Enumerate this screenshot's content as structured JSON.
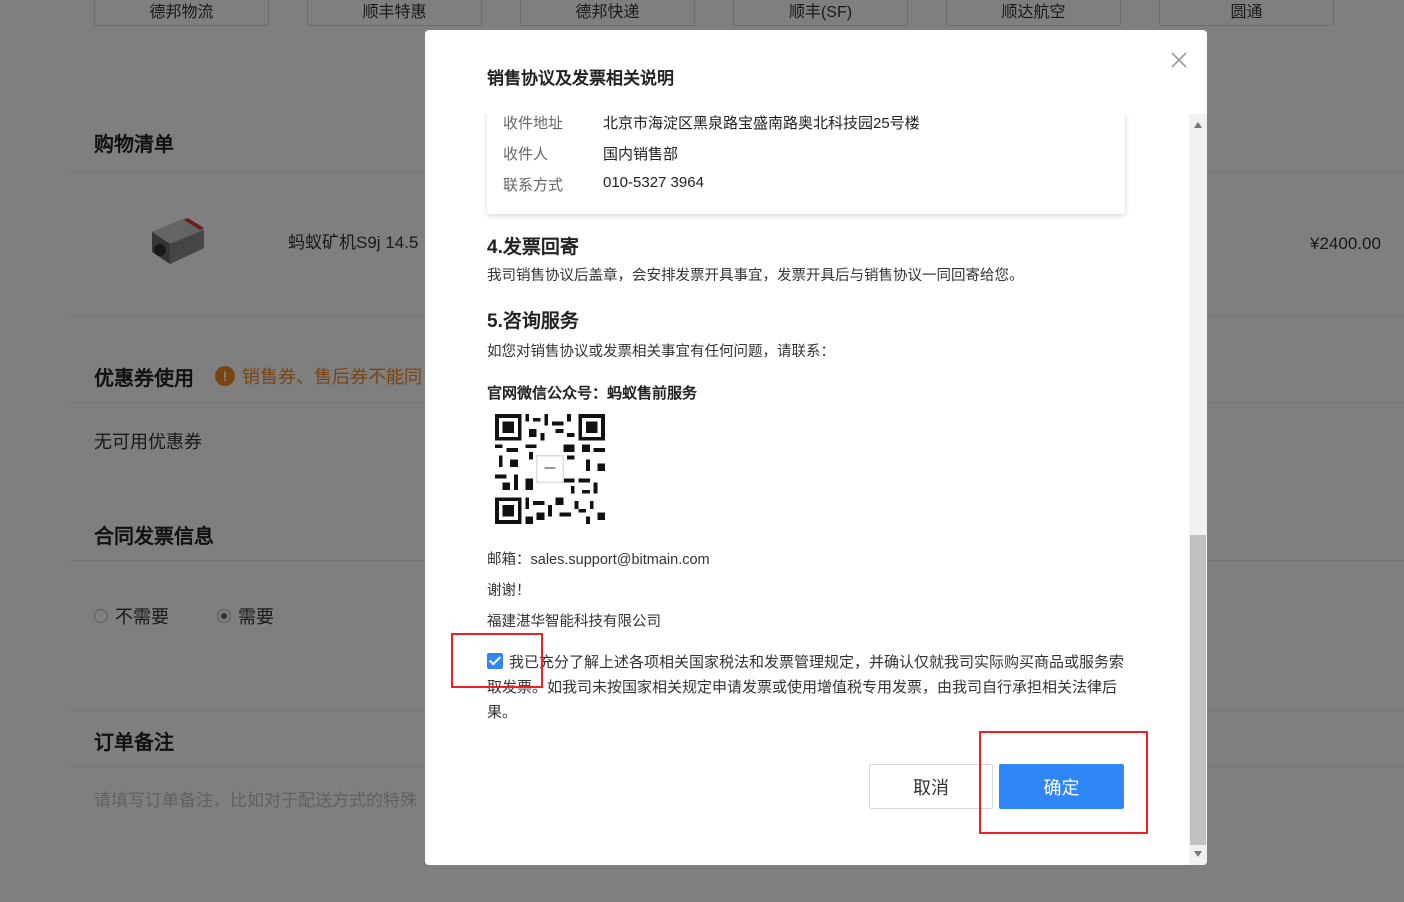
{
  "background": {
    "shipping_options": [
      "德邦物流",
      "顺丰特惠",
      "德邦快递",
      "顺丰(SF)",
      "顺达航空",
      "圆通"
    ],
    "cart_title": "购物清单",
    "product_name": "蚂蚁矿机S9j 14.5",
    "product_price": "¥2400.00",
    "coupon_title": "优惠券使用",
    "coupon_warning": "销售券、售后券不能同",
    "coupon_empty": "无可用优惠券",
    "invoice_title": "合同发票信息",
    "invoice_options": [
      "不需要",
      "需要"
    ],
    "invoice_selected": "需要",
    "remark_title": "订单备注",
    "remark_placeholder": "请填写订单备注，比如对于配送方式的特殊"
  },
  "modal": {
    "title": "销售协议及发票相关说明",
    "address_rows": [
      {
        "label": "收件地址",
        "value": "北京市海淀区黑泉路宝盛南路奥北科技园25号楼"
      },
      {
        "label": "收件人",
        "value": "国内销售部"
      },
      {
        "label": "联系方式",
        "value": "010-5327 3964"
      }
    ],
    "section4_title": "4.发票回寄",
    "section4_text": "我司销售协议后盖章，会安排发票开具事宜，发票开具后与销售协议一同回寄给您。",
    "section5_title": "5.咨询服务",
    "section5_text": "如您对销售协议或发票相关事宜有任何问题，请联系：",
    "wechat_label": "官网微信公众号：蚂蚁售前服务",
    "email": "邮箱：sales.support@bitmain.com",
    "thanks": "谢谢！",
    "company": "福建湛华智能科技有限公司",
    "agreement_checked": true,
    "agreement_text": "我已充分了解上述各项相关国家税法和发票管理规定，并确认仅就我司实际购买商品或服务索取发票。如我司未按国家相关规定申请发票或使用增值税专用发票，由我司自行承担相关法律后果。",
    "cancel_label": "取消",
    "ok_label": "确定"
  },
  "colors": {
    "primary": "#2f86f6",
    "warning": "#f08a24",
    "highlight": "#f02020",
    "overlay": "rgba(0,0,0,0.5)"
  }
}
